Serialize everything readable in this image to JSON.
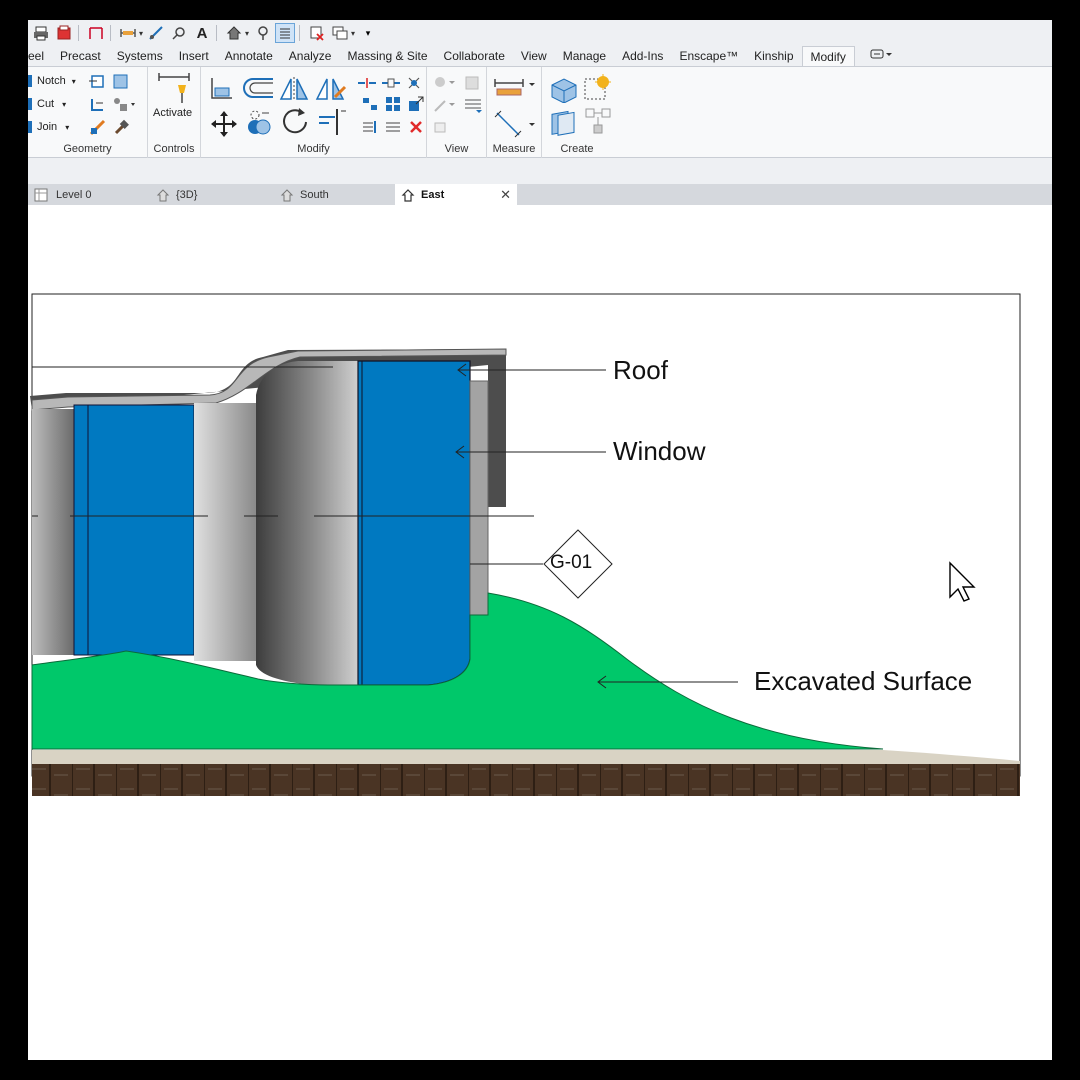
{
  "ribbon_tabs": [
    "eel",
    "Precast",
    "Systems",
    "Insert",
    "Annotate",
    "Analyze",
    "Massing & Site",
    "Collaborate",
    "View",
    "Manage",
    "Add-Ins",
    "Enscape™",
    "Kinship",
    "Modify"
  ],
  "geometry": {
    "notch": "Notch",
    "cut": "Cut",
    "join": "Join",
    "title": "Geometry"
  },
  "controls": {
    "activate": "Activate",
    "title": "Controls"
  },
  "panels": {
    "modify": "Modify",
    "view": "View",
    "measure": "Measure",
    "create": "Create"
  },
  "view_tabs": {
    "level0": "Level 0",
    "threed": "{3D}",
    "south": "South",
    "east": "East"
  },
  "drawing": {
    "callouts": {
      "roof": "Roof",
      "window": "Window",
      "excavated": "Excavated Surface"
    },
    "grid_tag": "G-01"
  },
  "colors": {
    "accent": "#0079c1",
    "terrain": "#00c86a",
    "soil": "#4a3424",
    "ground_band": "#d9d3c4"
  },
  "icons": [
    "print-icon",
    "sync-icon",
    "measure-icon",
    "align-dimension-icon",
    "tag-icon",
    "text-icon",
    "home-icon",
    "section-icon",
    "thin-lines-icon",
    "close-hidden-icon",
    "switch-windows-icon",
    "cursor-icon"
  ]
}
